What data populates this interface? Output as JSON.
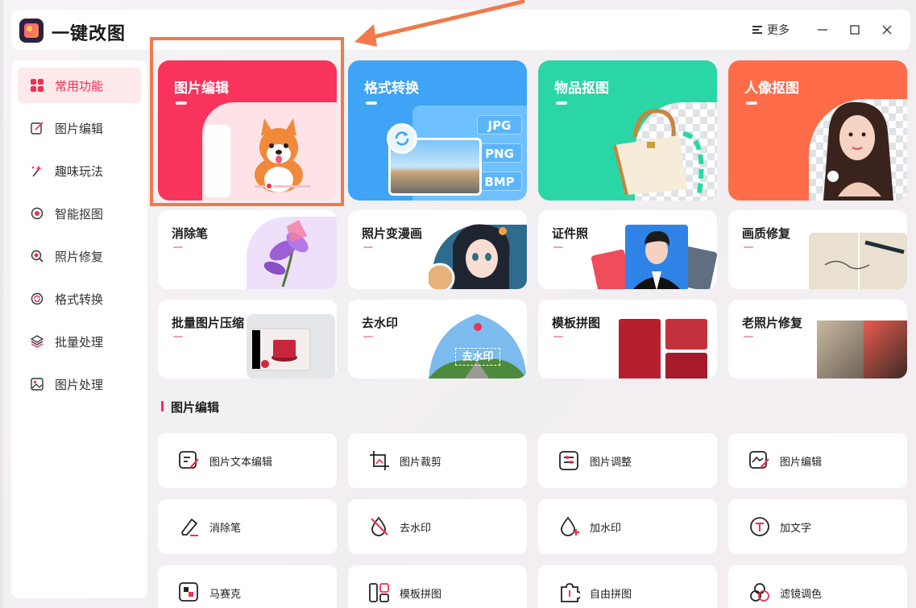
{
  "app": {
    "title": "一键改图",
    "more_label": "更多"
  },
  "colors": {
    "accent": "#f0304f",
    "highlight": "#f07a4a"
  },
  "sidebar": {
    "items": [
      {
        "label": "常用功能",
        "icon": "grid-icon",
        "active": true
      },
      {
        "label": "图片编辑",
        "icon": "edit-icon",
        "active": false
      },
      {
        "label": "趣味玩法",
        "icon": "sparkle-icon",
        "active": false
      },
      {
        "label": "智能抠图",
        "icon": "target-icon",
        "active": false
      },
      {
        "label": "照片修复",
        "icon": "repair-icon",
        "active": false
      },
      {
        "label": "格式转换",
        "icon": "convert-icon",
        "active": false
      },
      {
        "label": "批量处理",
        "icon": "layers-icon",
        "active": false
      },
      {
        "label": "图片处理",
        "icon": "image-icon",
        "active": false
      }
    ]
  },
  "featured": [
    {
      "label": "图片编辑",
      "color": "#f8335c"
    },
    {
      "label": "格式转换",
      "color": "#3fa3f6"
    },
    {
      "label": "物品抠图",
      "color": "#2bd6a6"
    },
    {
      "label": "人像抠图",
      "color": "#ff6c4a"
    }
  ],
  "format_tags": [
    "JPG",
    "PNG",
    "BMP"
  ],
  "cards": [
    {
      "label": "消除笔"
    },
    {
      "label": "照片变漫画"
    },
    {
      "label": "证件照"
    },
    {
      "label": "画质修复"
    },
    {
      "label": "批量图片压缩"
    },
    {
      "label": "去水印"
    },
    {
      "label": "模板拼图"
    },
    {
      "label": "老照片修复"
    }
  ],
  "watermark_tag": "去水印",
  "section": {
    "title": "图片编辑"
  },
  "tools": [
    {
      "label": "图片文本编辑",
      "icon": "text-edit-icon"
    },
    {
      "label": "图片裁剪",
      "icon": "crop-icon"
    },
    {
      "label": "图片调整",
      "icon": "adjust-icon"
    },
    {
      "label": "图片编辑",
      "icon": "image-edit-icon"
    },
    {
      "label": "消除笔",
      "icon": "eraser-icon"
    },
    {
      "label": "去水印",
      "icon": "no-watermark-icon"
    },
    {
      "label": "加水印",
      "icon": "add-watermark-icon"
    },
    {
      "label": "加文字",
      "icon": "add-text-icon"
    },
    {
      "label": "马赛克",
      "icon": "mosaic-icon"
    },
    {
      "label": "模板拼图",
      "icon": "template-icon"
    },
    {
      "label": "自由拼图",
      "icon": "puzzle-icon"
    },
    {
      "label": "滤镜调色",
      "icon": "filter-icon"
    }
  ]
}
